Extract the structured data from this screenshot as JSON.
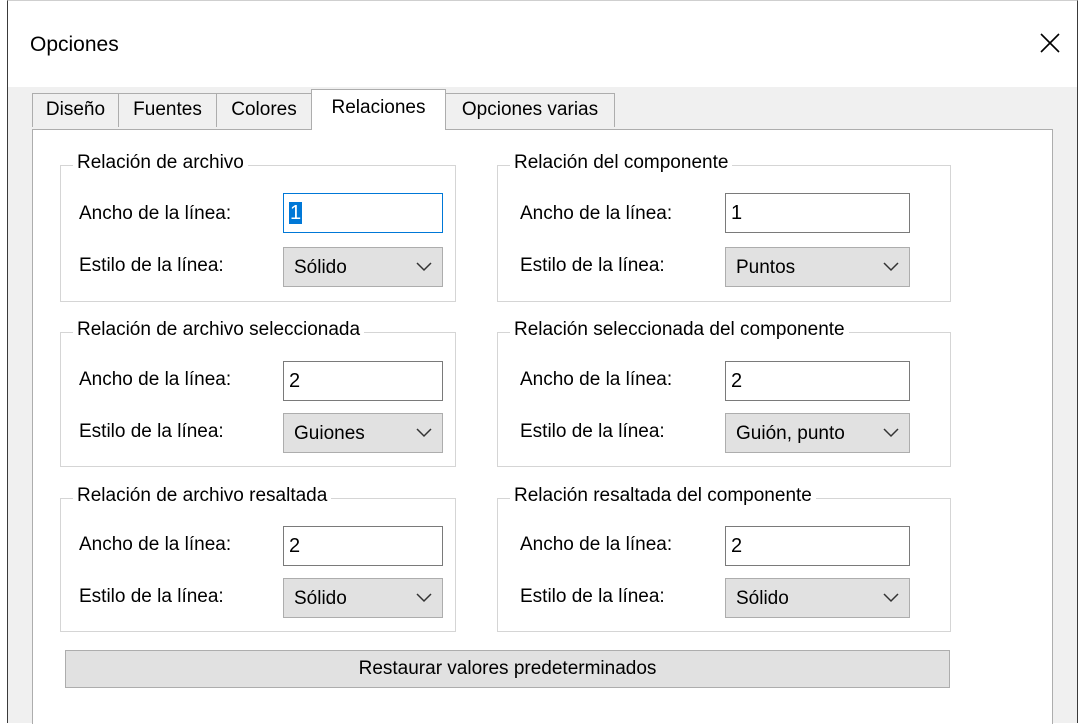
{
  "window": {
    "title": "Opciones"
  },
  "tabs": [
    {
      "label": "Diseño"
    },
    {
      "label": "Fuentes"
    },
    {
      "label": "Colores"
    },
    {
      "label": "Relaciones"
    },
    {
      "label": "Opciones varias"
    }
  ],
  "active_tab": "Relaciones",
  "common": {
    "width_label": "Ancho de la línea:",
    "style_label": "Estilo de la línea:"
  },
  "groups": {
    "file_rel": {
      "title": "Relación de archivo",
      "width": "1",
      "style": "Sólido"
    },
    "comp_rel": {
      "title": "Relación del componente",
      "width": "1",
      "style": "Puntos"
    },
    "file_sel": {
      "title": "Relación de archivo seleccionada",
      "width": "2",
      "style": "Guiones"
    },
    "comp_sel": {
      "title": "Relación seleccionada del componente",
      "width": "2",
      "style": "Guión, punto"
    },
    "file_hl": {
      "title": "Relación de archivo resaltada",
      "width": "2",
      "style": "Sólido"
    },
    "comp_hl": {
      "title": "Relación resaltada del componente",
      "width": "2",
      "style": "Sólido"
    }
  },
  "buttons": {
    "restore": "Restaurar valores predeterminados"
  },
  "colors": {
    "focus": "#0078d7",
    "panel": "#ffffff",
    "chrome": "#f0f0f0"
  }
}
